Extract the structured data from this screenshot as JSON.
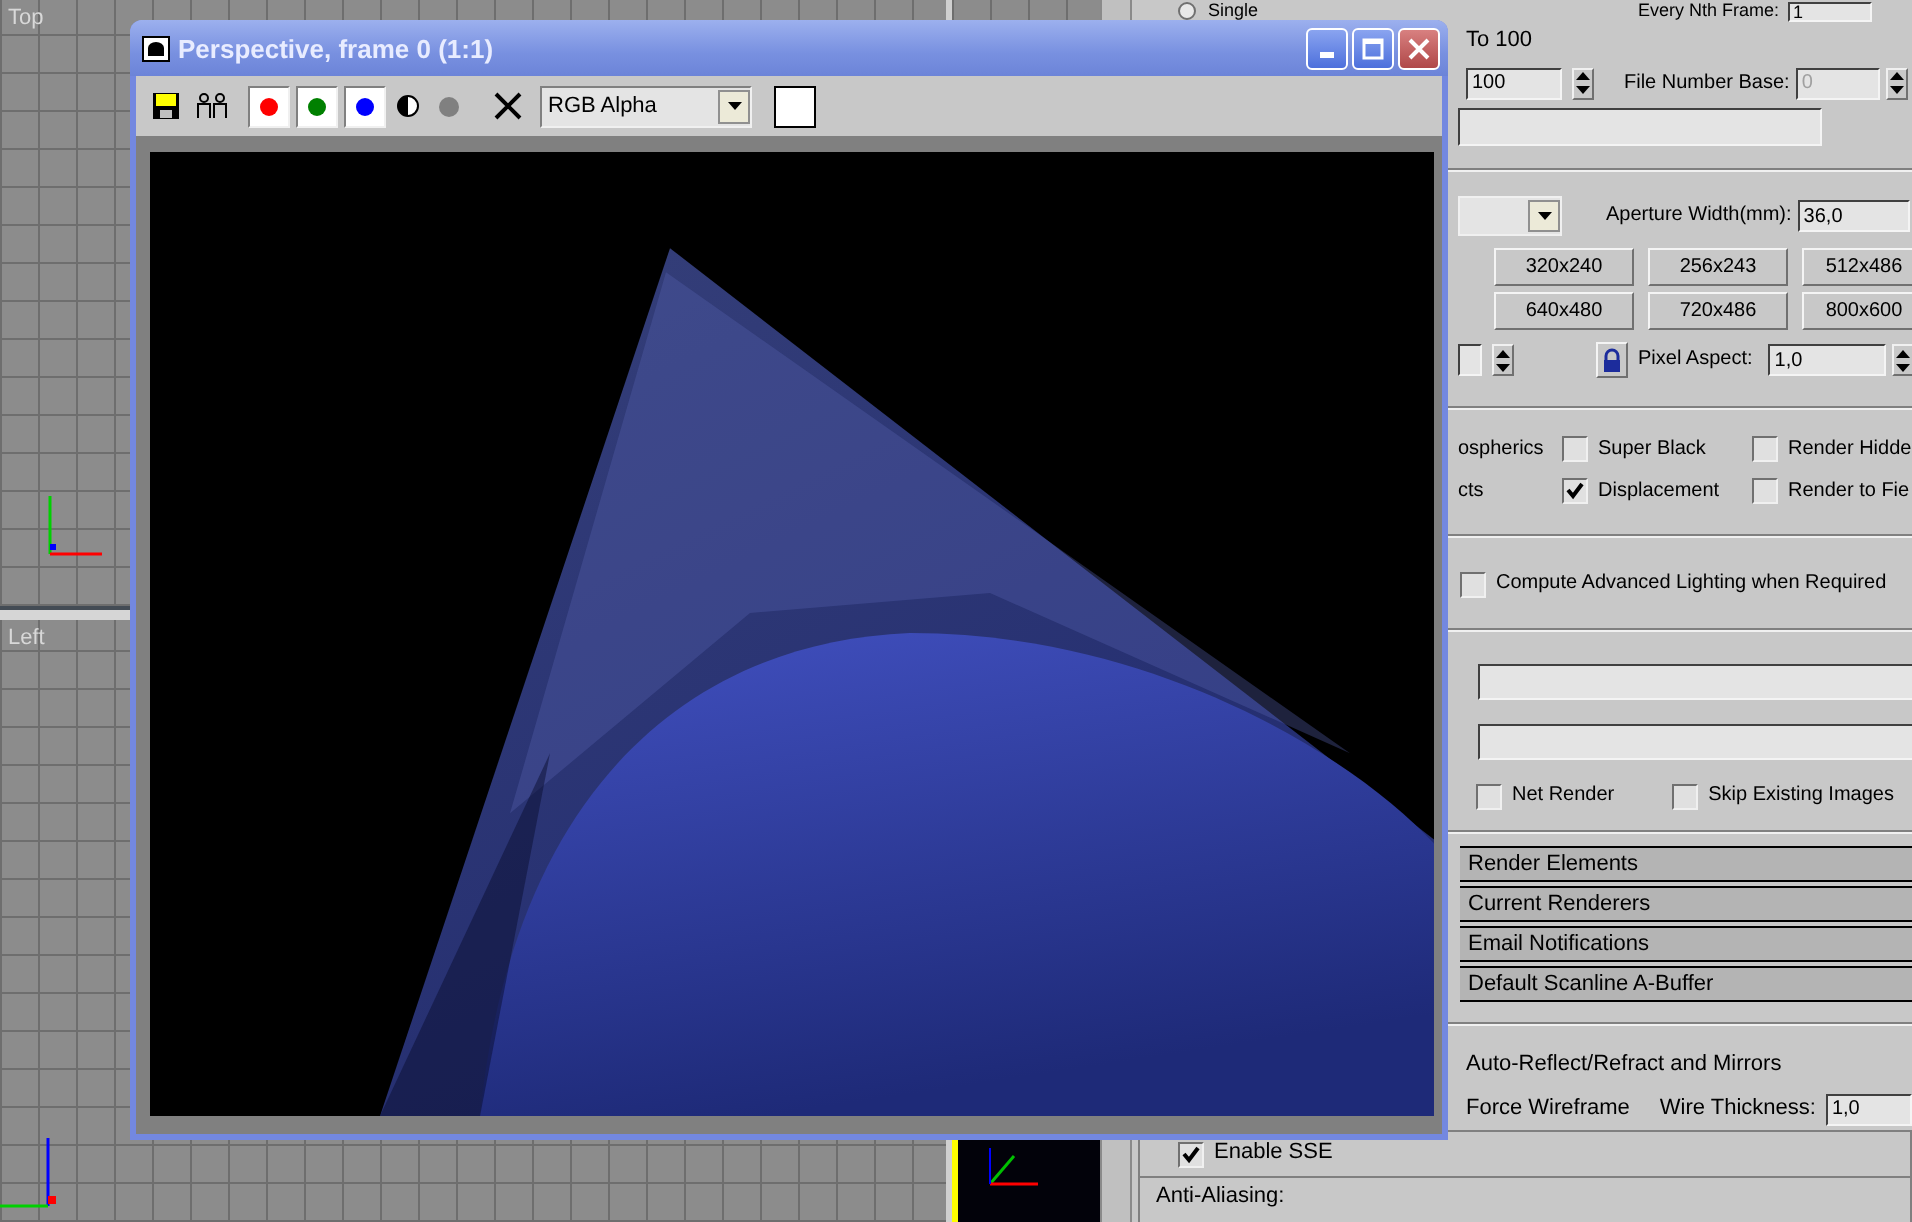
{
  "viewports": [
    {
      "label": "Top"
    },
    {
      "label": "Left"
    }
  ],
  "render_window": {
    "title": "Perspective, frame 0 (1:1)",
    "channels": [
      {
        "color": "#ff0000",
        "on": true
      },
      {
        "color": "#008000",
        "on": true
      },
      {
        "color": "#0000ff",
        "on": true
      }
    ],
    "display": "RGB Alpha"
  },
  "render_settings": {
    "single": {
      "label": "Single",
      "selected": false
    },
    "every_nth": {
      "label": "Every Nth Frame:",
      "value": "1"
    },
    "range_end": "To 100",
    "range_field": "100",
    "file_number_base": {
      "label": "File Number Base:",
      "value": "0",
      "disabled": true
    },
    "aperture": {
      "label": "Aperture Width(mm):",
      "value": "36,0"
    },
    "presets": [
      [
        "320x240",
        "256x243",
        "512x486"
      ],
      [
        "640x480",
        "720x486",
        "800x600"
      ]
    ],
    "pixel_aspect": {
      "label": "Pixel Aspect:",
      "value": "1,0"
    },
    "options": [
      {
        "prefix": "ospherics",
        "items": [
          {
            "label": "Super Black",
            "checked": false
          },
          {
            "label": "Render Hidde",
            "checked": false
          }
        ]
      },
      {
        "prefix": "cts",
        "items": [
          {
            "label": "Displacement",
            "checked": true
          },
          {
            "label": "Render to Fie",
            "checked": false
          }
        ]
      }
    ],
    "advanced_lighting": {
      "label": "Compute Advanced Lighting when Required",
      "checked": false
    },
    "network": [
      {
        "label": "Net Render",
        "checked": false
      },
      {
        "label": "Skip Existing Images",
        "checked": false
      }
    ],
    "rollouts": [
      "Render Elements",
      "Current Renderers",
      "Email Notifications",
      "Default Scanline A-Buffer"
    ],
    "auto_reflect": "Auto-Reflect/Refract and Mirrors",
    "force_wireframe": "Force Wireframe",
    "wire_thickness": {
      "label": "Wire Thickness:",
      "value": "1,0"
    },
    "enable_sse": {
      "label": "Enable SSE",
      "checked": true
    },
    "anti_aliasing": "Anti-Aliasing:"
  }
}
